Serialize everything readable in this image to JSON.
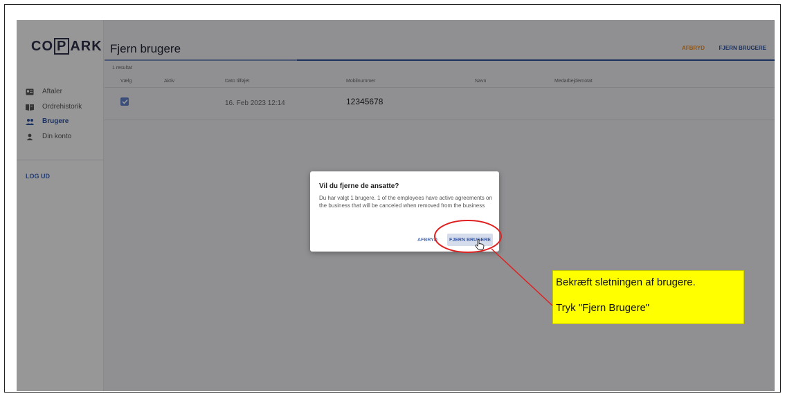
{
  "app": {
    "logo": "CO|P|ARK",
    "logo_parts": [
      "CO",
      "P",
      "ARK"
    ]
  },
  "sidebar": {
    "items": [
      {
        "label": "Aftaler",
        "icon": "id-card-icon",
        "active": false
      },
      {
        "label": "Ordrehistorik",
        "icon": "book-icon",
        "active": false
      },
      {
        "label": "Brugere",
        "icon": "users-icon",
        "active": true
      },
      {
        "label": "Din konto",
        "icon": "person-icon",
        "active": false
      }
    ],
    "logout_label": "LOG UD"
  },
  "header": {
    "title": "Fjern brugere",
    "cancel_label": "AFBRYD",
    "remove_label": "FJERN BRUGERE"
  },
  "table": {
    "results_text": "1 resultat",
    "columns": [
      "Vælg",
      "Aktiv",
      "Dato tilføjet",
      "Mobilnummer",
      "Navn",
      "Medarbejdernotat"
    ],
    "rows": [
      {
        "selected": true,
        "active": "",
        "date_added": "16. Feb 2023 12:14",
        "mobile": "12345678",
        "name": "",
        "note": ""
      }
    ]
  },
  "dialog": {
    "title": "Vil du fjerne de ansatte?",
    "body": "Du har valgt 1 brugere. 1 of the employees have active agreements on the business that will be canceled when removed from the business",
    "cancel_label": "AFBRYD",
    "confirm_label": "FJERN BRUGERE"
  },
  "annotation": {
    "line1": "Bekræft sletningen af brugere.",
    "line2": "Tryk \"Fjern Brugere\"",
    "highlight_color": "#e02020",
    "callout_color": "#ffff00"
  },
  "colors": {
    "accent": "#2c4f9a",
    "cancel": "#e08a2e",
    "checkbox": "#5e7fc4"
  }
}
